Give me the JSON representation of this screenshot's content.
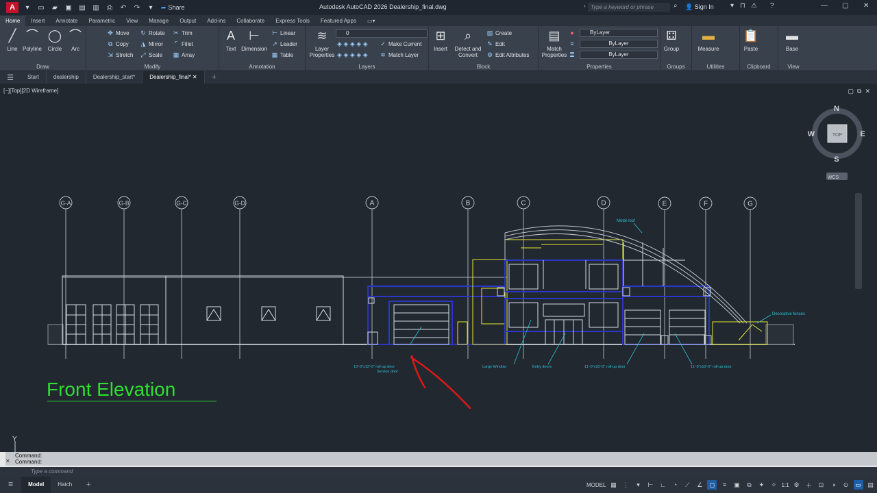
{
  "titlebar": {
    "app_logo": "A",
    "share_label": "Share",
    "title": "Autodesk AutoCAD 2026   Dealership_final.dwg",
    "search_placeholder": "Type a keyword or phrase",
    "signin_label": "Sign In"
  },
  "ribbon_tabs": [
    "Home",
    "Insert",
    "Annotate",
    "Parametric",
    "View",
    "Manage",
    "Output",
    "Add-ins",
    "Collaborate",
    "Express Tools",
    "Featured Apps"
  ],
  "ribbon": {
    "draw": {
      "title": "Draw",
      "line": "Line",
      "polyline": "Polyline",
      "circle": "Circle",
      "arc": "Arc"
    },
    "modify": {
      "title": "Modify",
      "move": "Move",
      "rotate": "Rotate",
      "trim": "Trim",
      "copy": "Copy",
      "mirror": "Mirror",
      "fillet": "Fillet",
      "stretch": "Stretch",
      "scale": "Scale",
      "array": "Array"
    },
    "annotation": {
      "title": "Annotation",
      "text": "Text",
      "dimension": "Dimension",
      "linear": "Linear",
      "leader": "Leader",
      "table": "Table"
    },
    "layers": {
      "title": "Layers",
      "layer_properties": "Layer Properties",
      "current_layer": "0",
      "make_current": "Make Current",
      "match_layer": "Match Layer"
    },
    "block": {
      "title": "Block",
      "insert": "Insert",
      "detect": "Detect and Convert",
      "create": "Create",
      "edit": "Edit",
      "edit_attributes": "Edit Attributes"
    },
    "properties": {
      "title": "Properties",
      "match": "Match Properties",
      "color": "ByLayer",
      "linetype": "ByLayer",
      "lineweight": "ByLayer"
    },
    "groups": {
      "title": "Groups",
      "group": "Group"
    },
    "utilities": {
      "title": "Utilities",
      "measure": "Measure"
    },
    "clipboard": {
      "title": "Clipboard",
      "paste": "Paste"
    },
    "view": {
      "title": "View",
      "base": "Base"
    }
  },
  "doc_tabs": [
    "Start",
    "dealership",
    "Dealership_start*",
    "Dealership_final*"
  ],
  "viewport": {
    "label": "[−][Top][2D Wireframe]",
    "viewcube": {
      "n": "N",
      "s": "S",
      "e": "E",
      "w": "W",
      "top": "TOP",
      "wcs": "WCS"
    },
    "ucs_y": "Y",
    "drawing_title": "Front Elevation",
    "grid_bubbles": [
      "G-A",
      "G-B",
      "G-C",
      "G-D",
      "A",
      "B",
      "C",
      "D",
      "E",
      "F",
      "G"
    ],
    "annotations": {
      "metal_roof": "Metal roof",
      "decorative_fences": "Decorative fences",
      "rollup_service": "10'-0\"x12'-0\" roll-up door",
      "service_door": "Service door",
      "large_window": "Large Window",
      "entry_doors": "Entry doors",
      "rollup_mid": "11'-0\"x10'-0\" roll-up door",
      "rollup_right": "11'-0\"x10'-0\" roll-up door"
    }
  },
  "command": {
    "history_1": "Command:",
    "history_2": "Command:",
    "placeholder": "Type a command"
  },
  "statusbar": {
    "tabs": [
      "Model",
      "Hatch"
    ],
    "model_label": "MODEL",
    "scale": "1:1"
  }
}
